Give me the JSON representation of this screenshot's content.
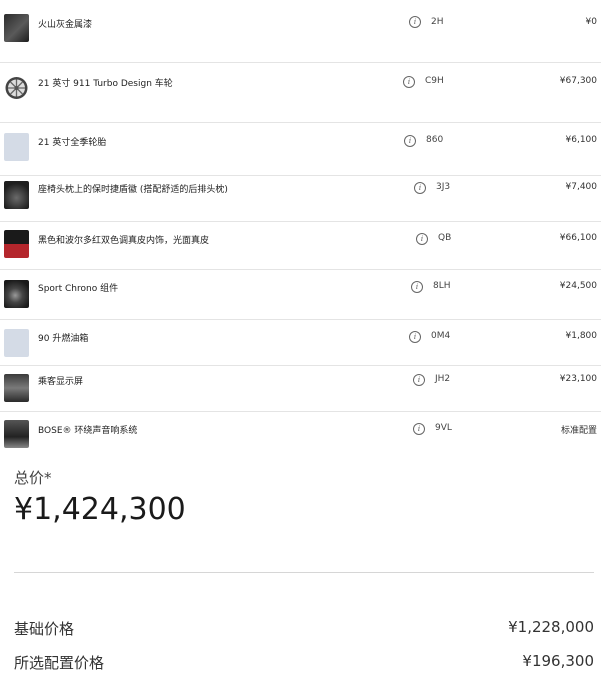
{
  "options": [
    {
      "name": "火山灰金属漆",
      "code": "2H",
      "price": "¥0",
      "thumb": "paint",
      "info_icon": "info-icon"
    },
    {
      "name": "21 英寸 911 Turbo Design 车轮",
      "code": "C9H",
      "price": "¥67,300",
      "thumb": "wheel",
      "info_icon": "info-icon"
    },
    {
      "name": "21 英寸全季轮胎",
      "code": "860",
      "price": "¥6,100",
      "thumb": "placeholder",
      "info_icon": "info-icon"
    },
    {
      "name": "座椅头枕上的保时捷盾徽 (搭配舒适的后排头枕)",
      "code": "3J3",
      "price": "¥7,400",
      "thumb": "headrest",
      "info_icon": "info-icon"
    },
    {
      "name": "黑色和波尔多红双色调真皮内饰，光面真皮",
      "code": "QB",
      "price": "¥66,100",
      "thumb": "two-tone",
      "info_icon": "info-icon"
    },
    {
      "name": "Sport Chrono 组件",
      "code": "8LH",
      "price": "¥24,500",
      "thumb": "chrono",
      "info_icon": "info-icon"
    },
    {
      "name": "90 升燃油箱",
      "code": "0M4",
      "price": "¥1,800",
      "thumb": "placeholder",
      "info_icon": "info-icon"
    },
    {
      "name": "乘客显示屏",
      "code": "JH2",
      "price": "¥23,100",
      "thumb": "display",
      "info_icon": "info-icon"
    },
    {
      "name": "BOSE® 环绕声音响系统",
      "code": "9VL",
      "price": "标准配置",
      "thumb": "speaker",
      "info_icon": "info-icon"
    }
  ],
  "total": {
    "label": "总价*",
    "value": "¥1,424,300"
  },
  "summary": [
    {
      "label": "基础价格",
      "value": "¥1,228,000"
    },
    {
      "label": "所选配置价格",
      "value": "¥196,300"
    }
  ],
  "colors": {
    "accent_red": "#b4262c",
    "divider": "#e4e4e4",
    "placeholder": "#d4dbe6"
  }
}
